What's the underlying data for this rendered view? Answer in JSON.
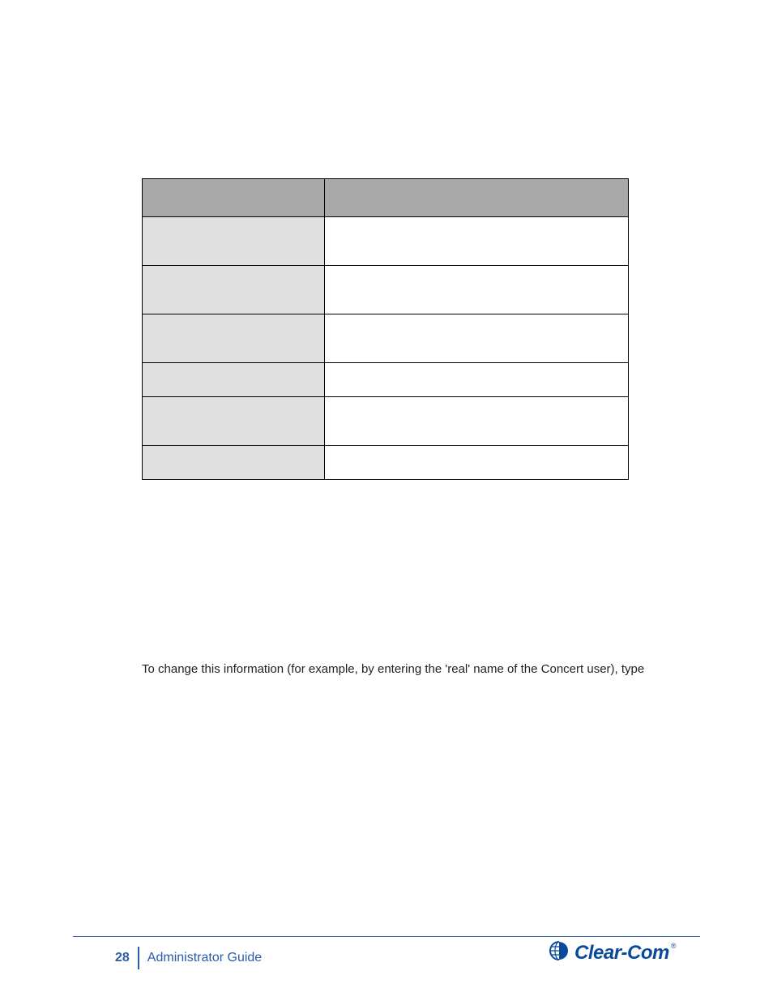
{
  "table": {
    "header": {
      "c1": "",
      "c2": ""
    },
    "rows": [
      {
        "label": "",
        "value": ""
      },
      {
        "label": "",
        "value": ""
      },
      {
        "label": "",
        "value": ""
      },
      {
        "label": "",
        "value": ""
      },
      {
        "label": "",
        "value": ""
      },
      {
        "label": "",
        "value": ""
      }
    ]
  },
  "paragraph": "To change this information (for example, by entering the 'real' name of the Concert user), type",
  "footer": {
    "page_number": "28",
    "title": "Administrator Guide",
    "brand": "Clear-Com",
    "reg": "®"
  }
}
